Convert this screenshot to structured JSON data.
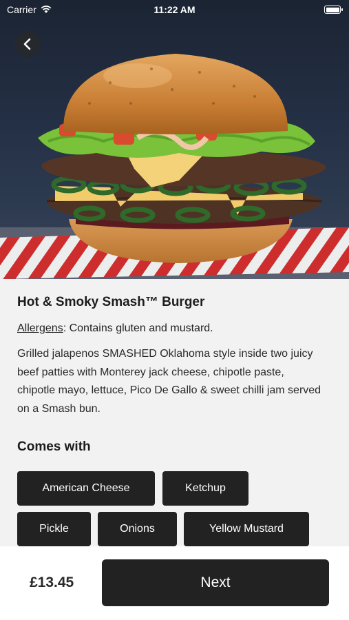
{
  "status_bar": {
    "carrier": "Carrier",
    "time": "11:22 AM"
  },
  "hero": {
    "image": "burger-photo",
    "back_icon": "chevron-left-icon"
  },
  "product": {
    "title": "Hot & Smoky Smash™ Burger",
    "allergens_label": "Allergens",
    "allergens_text": ": Contains gluten and mustard.",
    "description": "Grilled jalapenos SMASHED Oklahoma style inside two juicy beef patties with Monterey jack cheese, chipotle paste, chipotle mayo, lettuce, Pico De Gallo & sweet chilli jam served on a Smash bun."
  },
  "comes_with": {
    "heading": "Comes with",
    "items": [
      "American Cheese",
      "Ketchup",
      "Pickle",
      "Onions",
      "Yellow Mustard"
    ]
  },
  "footer": {
    "price": "£13.45",
    "next_label": "Next"
  },
  "colors": {
    "button_dark": "#222222",
    "page_background": "#f2f2f2",
    "bottom_bar": "#ffffff"
  }
}
